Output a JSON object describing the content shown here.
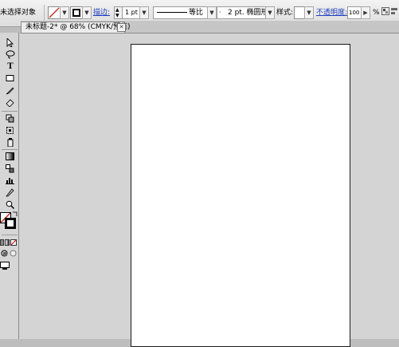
{
  "control_bar": {
    "selection_label": "未选择对象",
    "stroke_link": "描边:",
    "stroke_weight": "1 pt",
    "stroke_profile": "等比",
    "brush_label": "2 pt. 椭圆形",
    "style_label": "样式:",
    "opacity_link": "不透明度:",
    "opacity_value": "100",
    "opacity_unit": "%"
  },
  "document_tab": {
    "title": "未标题-2* @ 68% (CMYK/预览)",
    "close_glyph": "✕"
  },
  "tools": {
    "type_glyph": "T"
  },
  "colors": {
    "link": "#1f3fc0",
    "panel": "#d6d6d6",
    "canvas": "#d4d4d4",
    "artboard": "#ffffff",
    "no_fill_slash": "#d02020"
  }
}
